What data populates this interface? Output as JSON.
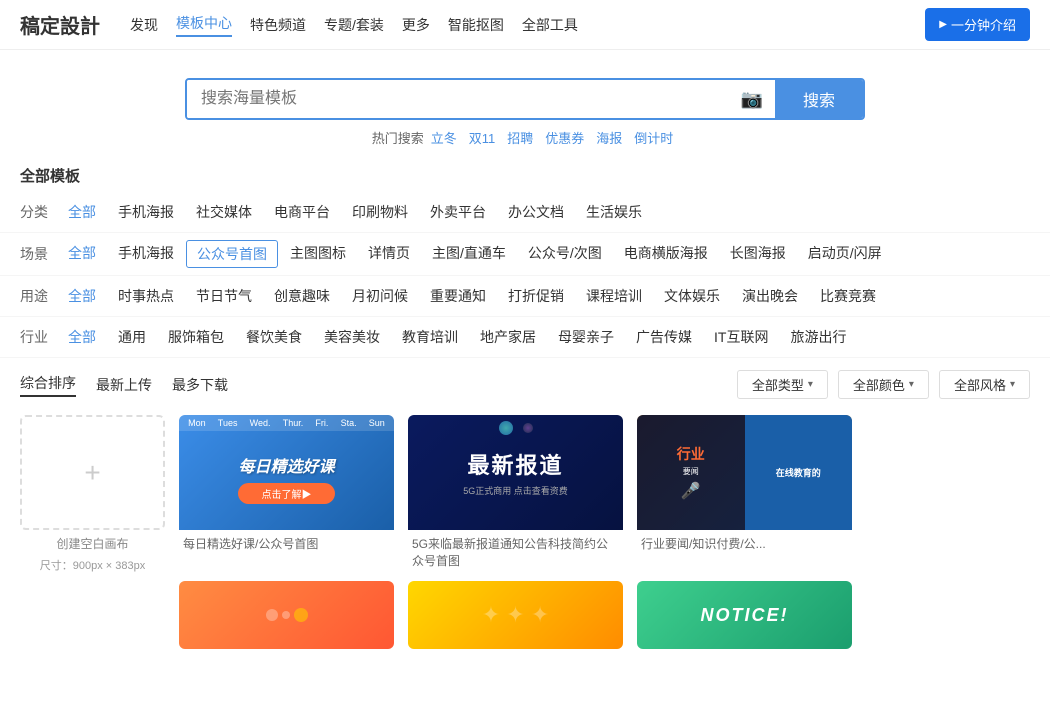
{
  "header": {
    "logo": "稿定設計",
    "nav_items": [
      "发现",
      "模板中心",
      "特色频道",
      "专题/套装",
      "更多",
      "智能抠图",
      "全部工具"
    ],
    "btn_intro": "一分钟介绍"
  },
  "search": {
    "placeholder": "搜索海量模板",
    "btn_label": "搜索",
    "hot_label": "热门搜索",
    "hot_items": [
      "立冬",
      "双11",
      "招聘",
      "优惠券",
      "海报",
      "倒计时"
    ]
  },
  "section": {
    "title": "全部模板"
  },
  "filters": {
    "category": {
      "label": "分类",
      "items": [
        "全部",
        "手机海报",
        "社交媒体",
        "电商平台",
        "印刷物料",
        "外卖平台",
        "办公文档",
        "生活娱乐"
      ]
    },
    "scene": {
      "label": "场景",
      "items": [
        "全部",
        "手机海报",
        "公众号首图",
        "主图图标",
        "详情页",
        "主图/直通车",
        "公众号/次图",
        "电商横版海报",
        "长图海报",
        "启动页/闪屏"
      ]
    },
    "usage": {
      "label": "用途",
      "items": [
        "全部",
        "时事热点",
        "节日节气",
        "创意趣味",
        "月初问候",
        "重要通知",
        "打折促销",
        "课程培训",
        "文体娱乐",
        "演出晚会",
        "比赛竞赛"
      ]
    },
    "industry": {
      "label": "行业",
      "items": [
        "全部",
        "通用",
        "服饰箱包",
        "餐饮美食",
        "美容美妆",
        "教育培训",
        "地产家居",
        "母婴亲子",
        "广告传媒",
        "IT互联网",
        "旅游出行"
      ]
    }
  },
  "sort": {
    "items": [
      "综合排序",
      "最新上传",
      "最多下载"
    ],
    "active": "综合排序"
  },
  "dropdowns": {
    "type": "全部类型",
    "color": "全部颜色",
    "style": "全部风格"
  },
  "create_card": {
    "label": "创建空白画布"
  },
  "size_info": "尺寸：900px × 383px",
  "cards": [
    {
      "title": "每日精选好课/公众号首图",
      "bg": "course",
      "text": "每日精选好课\n点击了解"
    },
    {
      "title": "5G来临最新报道通知公告科技简约公众号首图",
      "bg": "news",
      "text": "最新报道\n5G正式商用 点击查看资费"
    },
    {
      "title": "行业要闻/知识付费/公...",
      "bg": "industry",
      "text": "行业\n在线教育的"
    }
  ],
  "bottom_cards": [
    {
      "bg": "grad1",
      "text": ""
    },
    {
      "bg": "grad2",
      "text": ""
    },
    {
      "bg": "notice",
      "text": "NOTICE!"
    },
    {
      "bg": "grad4",
      "text": ""
    }
  ]
}
